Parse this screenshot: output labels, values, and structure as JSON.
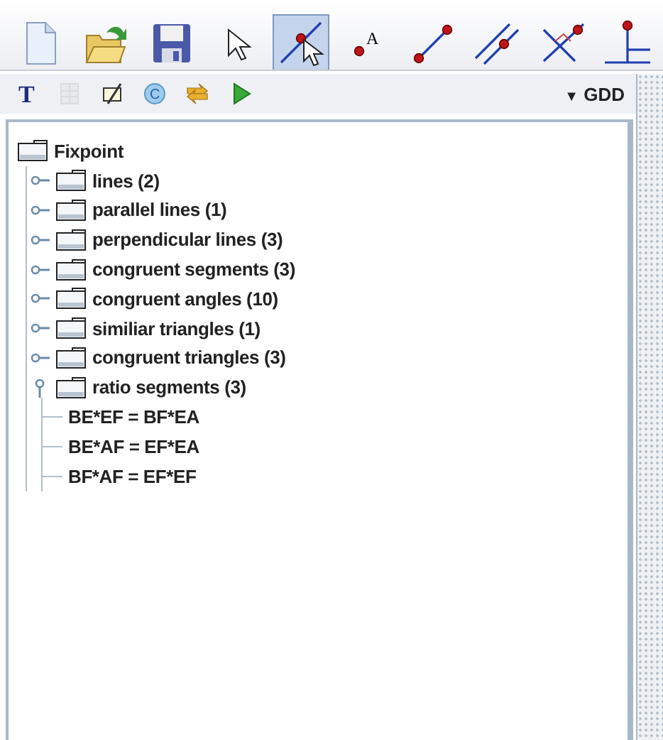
{
  "toolbar": {
    "tools": [
      {
        "kind": "new",
        "selected": false
      },
      {
        "kind": "open",
        "selected": false
      },
      {
        "kind": "save",
        "selected": false
      },
      {
        "kind": "pointer",
        "selected": false
      },
      {
        "kind": "point-on-line",
        "selected": true
      },
      {
        "kind": "labeled-point",
        "glyph": "A",
        "selected": false
      },
      {
        "kind": "segment",
        "selected": false
      },
      {
        "kind": "parallel",
        "selected": false
      },
      {
        "kind": "perpendicular",
        "selected": false
      },
      {
        "kind": "foot",
        "selected": false
      }
    ]
  },
  "secondary_toolbar": {
    "tools": [
      {
        "kind": "text",
        "glyph": "T"
      },
      {
        "kind": "grid",
        "disabled": true
      },
      {
        "kind": "pen"
      },
      {
        "kind": "copyright",
        "glyph": "C"
      },
      {
        "kind": "swap"
      },
      {
        "kind": "play"
      }
    ],
    "dropdown": {
      "arrow": "▼",
      "label": "GDD"
    }
  },
  "tree": {
    "label": "Fixpoint",
    "expanded": true,
    "children": [
      {
        "label": "lines (2)",
        "expanded": false
      },
      {
        "label": "parallel lines (1)",
        "expanded": false
      },
      {
        "label": "perpendicular lines (3)",
        "expanded": false
      },
      {
        "label": "congruent segments (3)",
        "expanded": false
      },
      {
        "label": "congruent angles (10)",
        "expanded": false
      },
      {
        "label": "similiar triangles (1)",
        "expanded": false
      },
      {
        "label": "congruent triangles (3)",
        "expanded": false
      },
      {
        "label": "ratio segments (3)",
        "expanded": true,
        "children": [
          {
            "label": "BE*EF = BF*EA"
          },
          {
            "label": "BE*AF = EF*EA"
          },
          {
            "label": "BF*AF = EF*EF"
          }
        ]
      }
    ]
  }
}
